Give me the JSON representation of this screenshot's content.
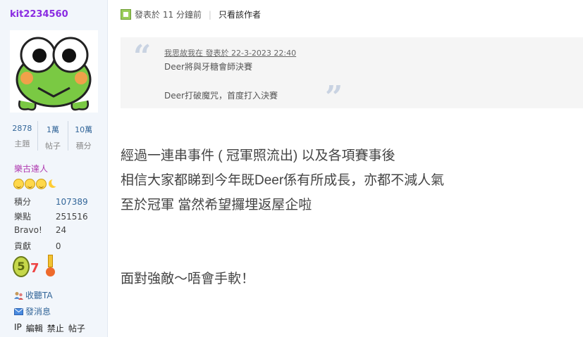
{
  "author": {
    "username": "kit2234560",
    "avatar_icon": "keroppi-frog-avatar",
    "stats": [
      {
        "value": "2878",
        "label": "主題"
      },
      {
        "value": "1萬",
        "label": "帖子"
      },
      {
        "value": "10萬",
        "label": "積分"
      }
    ],
    "rank_title": "樂古達人",
    "rank_icons": [
      "star-icon",
      "star-icon",
      "star-icon",
      "moon-icon"
    ],
    "info": [
      {
        "key": "積分",
        "value": "107389"
      },
      {
        "key": "樂點",
        "value": "251516"
      },
      {
        "key": "Bravo!",
        "value": "24"
      },
      {
        "key": "貢獻",
        "value": "0"
      }
    ],
    "medals": [
      "medal-5-icon",
      "medal-7-icon",
      "medal-ribbon-icon"
    ],
    "actions": {
      "follow": "收聽TA",
      "message": "發消息"
    },
    "admin": [
      "IP",
      "編輯",
      "禁止",
      "帖子"
    ]
  },
  "post": {
    "meta_time": "發表於 11 分鐘前",
    "only_author": "只看該作者",
    "quote": {
      "header": "我思故我在 發表於 22-3-2023 22:40",
      "lines": [
        "Deer將與牙糖會師決賽",
        "Deer打破魔咒，首度打入決賽"
      ]
    },
    "body": [
      "經過一連串事件 ( 冠軍照流出) 以及各項賽事後",
      "相信大家都睇到今年既Deer係有所成長，亦都不減人氣",
      "至於冠軍 當然希望攞埋返屋企啦",
      "面對強敵～唔會手軟！"
    ]
  },
  "colors": {
    "username": "#8a2be2",
    "link": "#336699",
    "sidebar_bg": "#f2f6fb",
    "quote_bg": "#f5f5f5"
  }
}
